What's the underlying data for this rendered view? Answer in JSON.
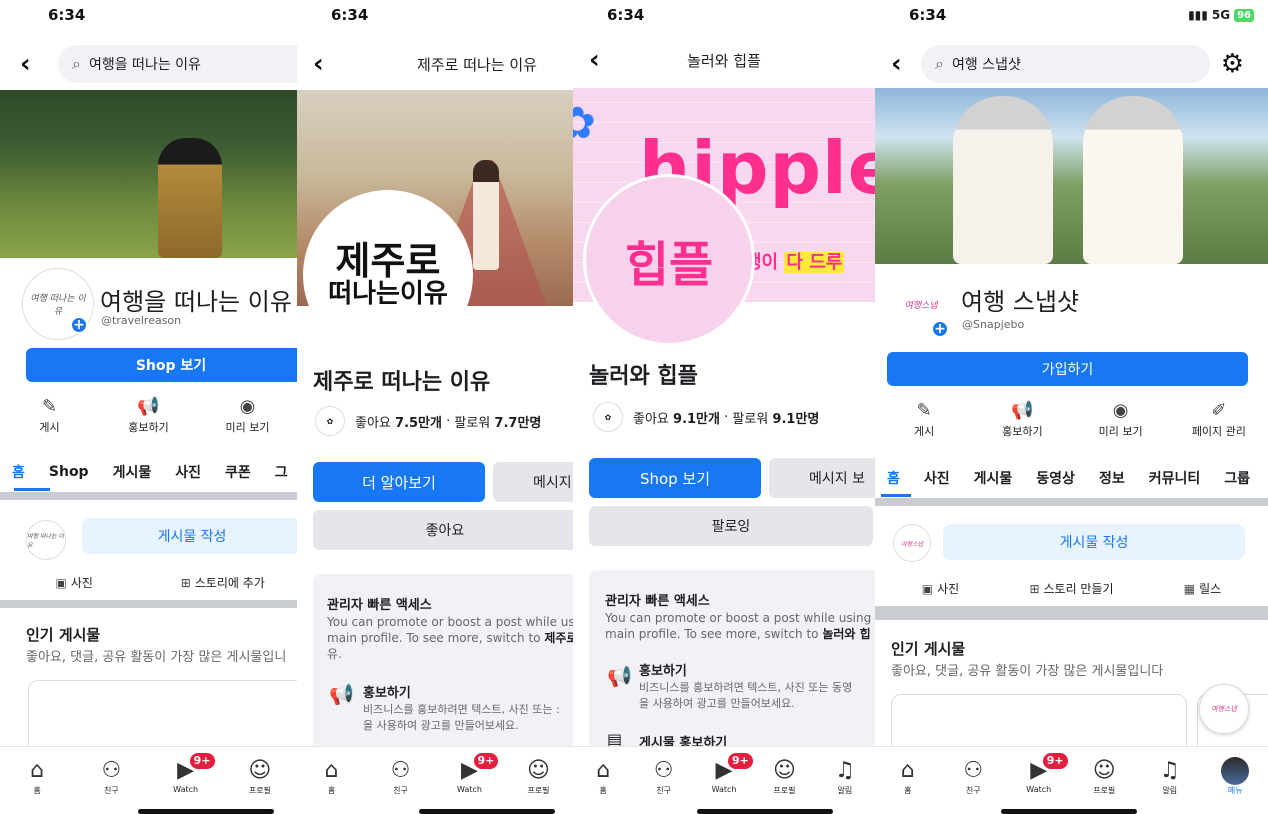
{
  "status": {
    "time": "6:34",
    "network": "5G",
    "battery": "96"
  },
  "p1": {
    "search_text": "여행을 떠나는 이유",
    "page_name": "여행을 떠나는 이유",
    "handle": "@travelreason",
    "shop_button": "Shop 보기",
    "actions": [
      "게시",
      "홍보하기",
      "미리 보기"
    ],
    "tabs": [
      "홈",
      "Shop",
      "게시물",
      "사진",
      "쿠폰",
      "그"
    ],
    "composer": "게시물 작성",
    "chips": [
      "사진",
      "스토리에 추가"
    ],
    "popular_title": "인기 게시물",
    "popular_sub": "좋아요, 댓글, 공유 활동이 가장 많은 게시물입니",
    "avatar_logo": "여행 떠나는 이유"
  },
  "p2": {
    "title": "제주로 떠나는 이유",
    "calligraphy_line1": "제주로",
    "calligraphy_line2": "떠나는이유",
    "page_name": "제주로 떠나는 이유",
    "likes_label": "좋아요",
    "likes_value": "7.5만개",
    "followers_label": "팔로워",
    "followers_value": "7.7만명",
    "learn_more": "더 알아보기",
    "message": "메시지",
    "like_button": "좋아요",
    "admin_title": "관리자 빠른 액세스",
    "admin_desc_line1": "You can promote or boost a post while us",
    "admin_desc_line2_pre": "main profile. To see more, switch to ",
    "admin_desc_line2_bold": "제주로",
    "admin_desc_line3": "유.",
    "promo_title": "홍보하기",
    "promo_desc_line1": "비즈니스를 홍보하려면 텍스트, 사진 또는 :",
    "promo_desc_line2": "을 사용하여 광고를 만들어보세요."
  },
  "p3": {
    "title": "놀러와 힙플",
    "cover_text": "hipple",
    "avatar_text": "힙플",
    "cover_strip_pink": "쟁이",
    "cover_strip_yellow": "다 드루",
    "page_name": "놀러와 힙플",
    "likes_label": "좋아요",
    "likes_value": "9.1만개",
    "followers_label": "팔로워",
    "followers_value": "9.1만명",
    "shop_button": "Shop 보기",
    "message": "메시지 보",
    "follow_button": "팔로잉",
    "admin_title": "관리자 빠른 액세스",
    "admin_desc_line1": "You can promote or boost a post while using",
    "admin_desc_line2_pre": "main profile. To see more, switch to ",
    "admin_desc_line2_bold": "놀러와 힙",
    "promo_title": "홍보하기",
    "promo_desc_line1": "비즈니스를 홍보하려면 텍스트, 사진 또는 동영",
    "promo_desc_line2": "을 사용하여 광고를 만들어보세요.",
    "promo2_title": "게시물 홍보하기"
  },
  "p4": {
    "search_text": "여행 스냅샷",
    "page_name": "여행 스냅샷",
    "handle": "@Snapjebo",
    "join_button": "가입하기",
    "actions": [
      "게시",
      "홍보하기",
      "미리 보기",
      "페이지 관리"
    ],
    "tabs": [
      "홈",
      "사진",
      "게시물",
      "동영상",
      "정보",
      "커뮤니티",
      "그룹"
    ],
    "composer": "게시물 작성",
    "chips": [
      "사진",
      "스토리 만들기",
      "릴스"
    ],
    "popular_title": "인기 게시물",
    "popular_sub": "좋아요, 댓글, 공유 활동이 가장 많은 게시물입니다",
    "avatar_logo": "여행스냅"
  },
  "bottom_nav": {
    "home": "홈",
    "friends": "친구",
    "watch": "Watch",
    "profile": "프로필",
    "notifications": "알림",
    "menu": "메뉴",
    "watch_badge": "9+"
  },
  "colors": {
    "accent": "#1877f2",
    "badge": "#e41e3f",
    "hipple_pink": "#ff2f8f"
  }
}
